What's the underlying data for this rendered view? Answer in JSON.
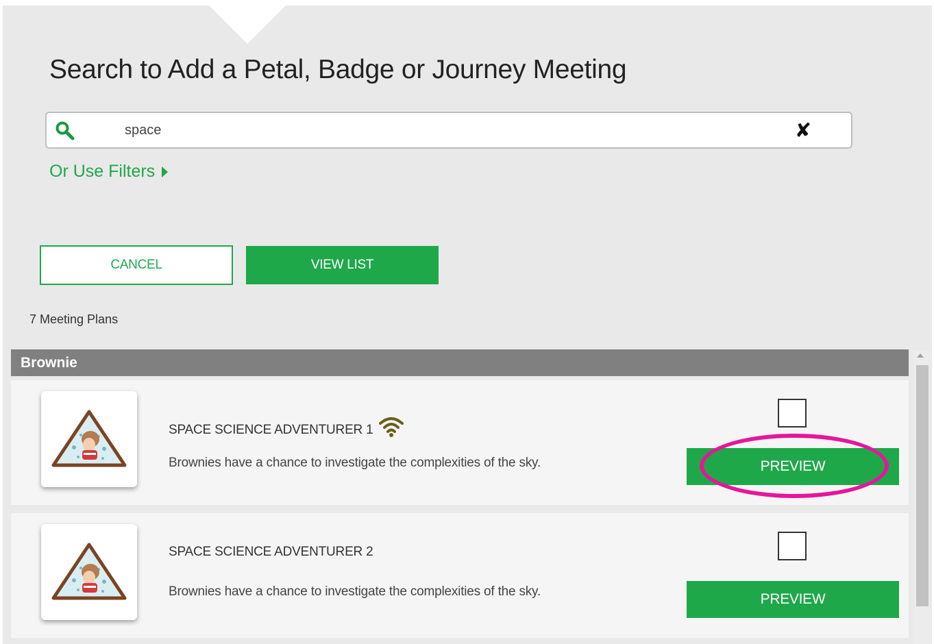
{
  "dialog": {
    "title": "Search to Add a Petal, Badge or Journey Meeting"
  },
  "search": {
    "value": "space",
    "clear_icon": "close-x-icon",
    "search_icon": "magnifier-icon"
  },
  "filters_link": "Or Use Filters",
  "buttons": {
    "cancel": "CANCEL",
    "view_list": "VIEW LIST"
  },
  "results_count": "7 Meeting Plans",
  "group": {
    "name": "Brownie"
  },
  "results": [
    {
      "title": "SPACE SCIENCE ADVENTURER 1",
      "description": "Brownies have a chance to investigate the complexities of the sky.",
      "has_online_icon": true,
      "checked": false,
      "preview_label": "PREVIEW"
    },
    {
      "title": "SPACE SCIENCE ADVENTURER 2",
      "description": "Brownies have a chance to investigate the complexities of the sky.",
      "has_online_icon": false,
      "checked": false,
      "preview_label": "PREVIEW"
    }
  ],
  "colors": {
    "accent_green": "#1ea84a",
    "highlight_magenta": "#e6169a",
    "group_header_gray": "#808080",
    "panel_background": "#e9e9e9"
  }
}
